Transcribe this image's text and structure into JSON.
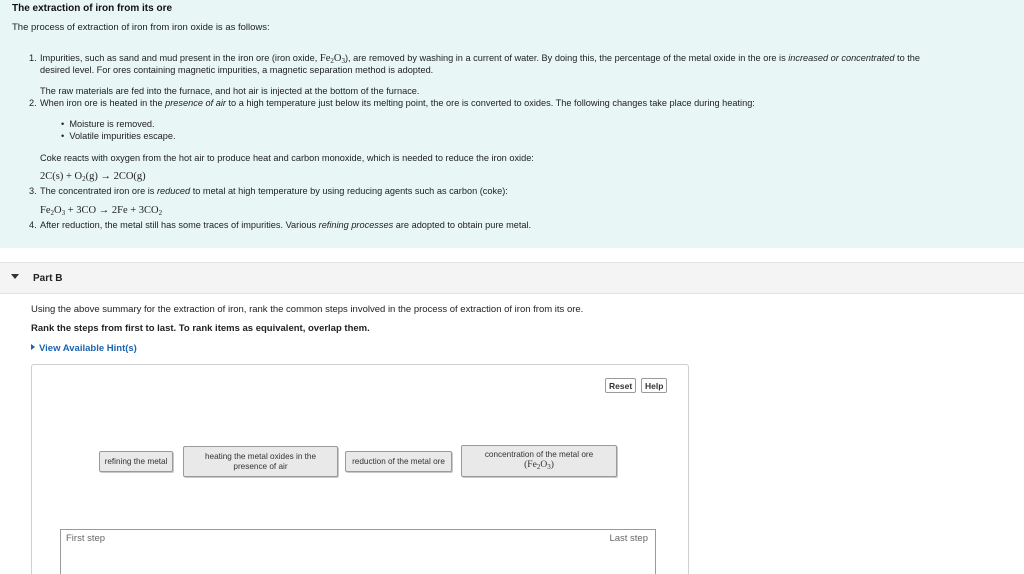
{
  "intro": {
    "title": "The extraction of iron from its ore",
    "lead": "The process of extraction of iron from iron oxide is as follows:",
    "step1": {
      "num": "1.",
      "line1_a": "Impurities, such as sand and mud present in the iron ore (iron oxide, ",
      "line1_formula_fe": "Fe",
      "line1_formula_fe_sub": "2",
      "line1_formula_o": "O",
      "line1_formula_o_sub": "3",
      "line1_b": "), are removed by washing in a current of water. By doing this, the percentage of the metal oxide in the ore is ",
      "line1_italic": "increased or concentrated",
      "line1_c": " to the",
      "line2": "desired level. For ores containing magnetic impurities, a magnetic separation method is adopted.",
      "line3": "The raw materials are fed into the furnace, and hot air is injected at the bottom of the furnace."
    },
    "step2": {
      "num": "2.",
      "a": "When iron ore is heated in the ",
      "italic": "presence of air",
      "b": " to a high temperature just below its melting point, the ore is converted to oxides. The following changes take place during heating:",
      "bullets": [
        "Moisture is removed.",
        "Volatile impurities escape."
      ],
      "coke": "Coke reacts with oxygen from the hot air to produce heat and carbon monoxide, which is needed to reduce the iron oxide:",
      "eq": {
        "lhs1": "2C(s) + O",
        "lhs1_sub": "2",
        "lhs2": "(g) → 2CO(g)"
      }
    },
    "step3": {
      "num": "3.",
      "a": "The concentrated iron ore is ",
      "italic": "reduced",
      "b": " to metal at high temperature by using reducing agents such as carbon (coke):",
      "eq": {
        "fe": "Fe",
        "fe_sub": "2",
        "o": "O",
        "o_sub": "3",
        "mid": " + 3CO → 2Fe + 3CO",
        "co_sub": "2"
      }
    },
    "step4": {
      "num": "4.",
      "a": "After reduction, the metal still has some traces of impurities. Various ",
      "italic": "refining processes",
      "b": " are adopted to obtain pure metal."
    }
  },
  "partB": {
    "title": "Part B",
    "question": "Using the above summary for the extraction of iron, rank the common steps involved in the process of extraction of iron from its ore.",
    "instruction": "Rank the steps from first to last. To rank items as equivalent, overlap them.",
    "hints": "View Available Hint(s)",
    "reset": "Reset",
    "help": "Help",
    "tiles": {
      "t1": "refining the metal",
      "t2_line1": "heating the metal oxides in the",
      "t2_line2": "presence of air",
      "t3": "reduction of the metal ore",
      "t4_line1": "concentration of the metal ore",
      "t4_fe": "(Fe",
      "t4_fe_sub": "2",
      "t4_o": "O",
      "t4_o_sub": "3",
      "t4_close": ")"
    },
    "first_step": "First step",
    "last_step": "Last step"
  }
}
